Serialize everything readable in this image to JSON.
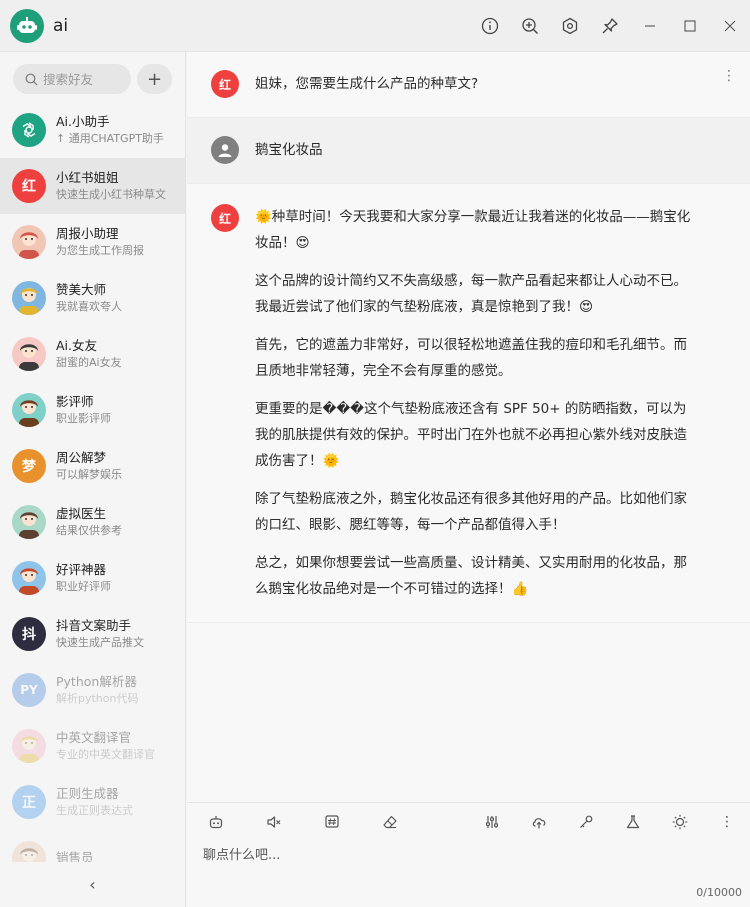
{
  "app": {
    "title": "ai"
  },
  "sidebar": {
    "search_placeholder": "搜索好友",
    "add_label": "+",
    "contacts": [
      {
        "name": "Ai.小助手",
        "desc": "↑ 通用CHATGPT助手",
        "avatar": "",
        "icon": "openai-logo-icon",
        "color": "#1ea383"
      },
      {
        "name": "小红书姐姐",
        "desc": "快速生成小红书种草文",
        "avatar": "红",
        "icon": "",
        "color": "#ef4040"
      },
      {
        "name": "周报小助理",
        "desc": "为您生成工作周报",
        "avatar": "",
        "icon": "girl-avatar-icon",
        "color": "#f2c6b4"
      },
      {
        "name": "赞美大师",
        "desc": "我就喜欢夸人",
        "avatar": "",
        "icon": "boy-avatar-icon",
        "color": "#7fb7e0"
      },
      {
        "name": "Ai.女友",
        "desc": "甜蜜的Ai女友",
        "avatar": "",
        "icon": "girlfriend-avatar-icon",
        "color": "#f6c9c4"
      },
      {
        "name": "影评师",
        "desc": "职业影评师",
        "avatar": "",
        "icon": "critic-avatar-icon",
        "color": "#7fd0c9"
      },
      {
        "name": "周公解梦",
        "desc": "可以解梦娱乐",
        "avatar": "梦",
        "icon": "",
        "color": "#e8912d"
      },
      {
        "name": "虚拟医生",
        "desc": "结果仅供参考",
        "avatar": "",
        "icon": "doctor-avatar-icon",
        "color": "#a9d8c9"
      },
      {
        "name": "好评神器",
        "desc": "职业好评师",
        "avatar": "",
        "icon": "glasses-avatar-icon",
        "color": "#8fc3ea"
      },
      {
        "name": "抖音文案助手",
        "desc": "快速生成产品推文",
        "avatar": "抖",
        "icon": "",
        "color": "#2d2d3f"
      },
      {
        "name": "Python解析器",
        "desc": "解析python代码",
        "avatar": "PY",
        "icon": "",
        "color": "#4f8ed9"
      },
      {
        "name": "中英文翻译官",
        "desc": "专业的中英文翻译官",
        "avatar": "",
        "icon": "translator-avatar-icon",
        "color": "#f1b7c8"
      },
      {
        "name": "正则生成器",
        "desc": "生成正则表达式",
        "avatar": "正",
        "icon": "",
        "color": "#4a9be6"
      },
      {
        "name": "销售员",
        "desc": "",
        "avatar": "",
        "icon": "sales-avatar-icon",
        "color": "#e8c9b0"
      }
    ],
    "collapse_label": "‹"
  },
  "chat": {
    "bot_avatar": "红",
    "greeting": "姐妹，您需要生成什么产品的种草文?",
    "user_message": "鹅宝化妆品",
    "reply": [
      "🌞种草时间！今天我要和大家分享一款最近让我着迷的化妆品——鹅宝化妆品！😍",
      "这个品牌的设计简约又不失高级感，每一款产品看起来都让人心动不已。我最近尝试了他们家的气垫粉底液，真是惊艳到了我！😍",
      "首先，它的遮盖力非常好，可以很轻松地遮盖住我的痘印和毛孔细节。而且质地非常轻薄，完全不会有厚重的感觉。",
      "更重要的是���这个气垫粉底液还含有 SPF 50+ 的防晒指数，可以为我的肌肤提供有效的保护。平时出门在外也就不必再担心紫外线对皮肤造成伤害了！🌞",
      "除了气垫粉底液之外，鹅宝化妆品还有很多其他好用的产品。比如他们家的口红、眼影、腮红等等，每一个产品都值得入手！",
      "总之，如果你想要尝试一些高质量、设计精美、又实用耐用的化妆品，那么鹅宝化妆品绝对是一个不可错过的选择！👍"
    ]
  },
  "input": {
    "placeholder": "聊点什么吧...",
    "counter": "0/10000"
  },
  "colors": {
    "accent": "#1e9e79",
    "bot": "#ef4040"
  }
}
